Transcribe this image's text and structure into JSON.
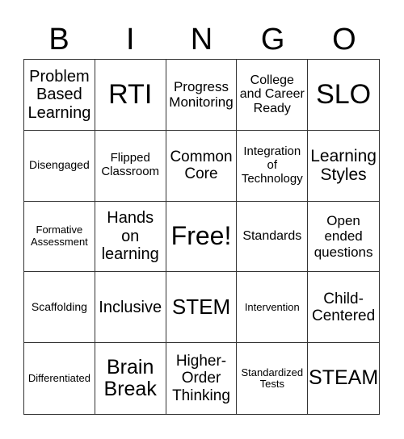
{
  "header": {
    "letters": [
      "B",
      "I",
      "N",
      "G",
      "O"
    ]
  },
  "board": {
    "cells": [
      "Problem Based Learning",
      "RTI",
      "Progress Monitoring",
      "College and Career Ready",
      "SLO",
      "Disengaged",
      "Flipped Classroom",
      "Common Core",
      "Integration of Technology",
      "Learning Styles",
      "Formative Assessment",
      "Hands on learning",
      "Free!",
      "Standards",
      "Open ended questions",
      "Scaffolding",
      "Inclusive",
      "STEM",
      "Intervention",
      "Child-Centered",
      "Differentiated",
      "Brain Break",
      "Higher-Order Thinking",
      "Standardized Tests",
      "STEAM"
    ]
  }
}
